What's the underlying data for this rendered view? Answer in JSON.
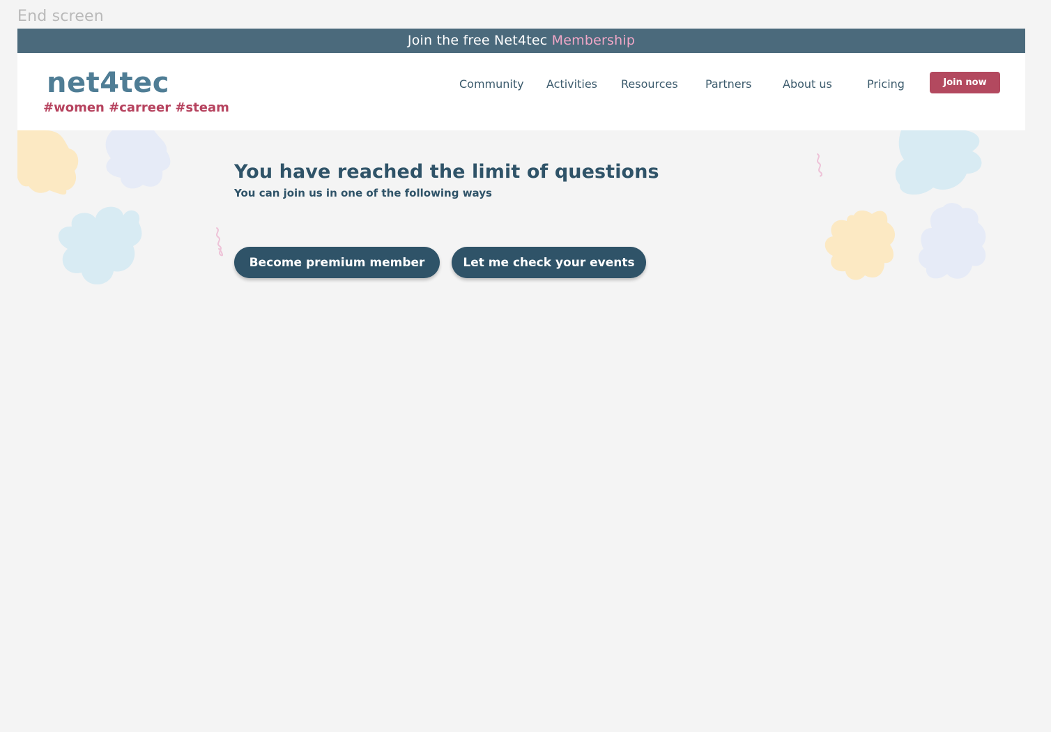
{
  "frame_label": "End screen",
  "promo": {
    "text": "Join the free Net4tec ",
    "highlight": "Membership"
  },
  "brand": {
    "logo": "net4tec",
    "tagline": "#women #carreer #steam"
  },
  "nav": {
    "items": [
      {
        "label": "Community"
      },
      {
        "label": "Activities"
      },
      {
        "label": "Resources"
      },
      {
        "label": "Partners"
      },
      {
        "label": "About us"
      },
      {
        "label": "Pricing"
      }
    ],
    "cta_label": "Join now"
  },
  "main": {
    "headline": "You have reached the limit of questions",
    "subline": "You can join us in one of the following ways",
    "buttons": [
      {
        "label": "Become premium member"
      },
      {
        "label": "Let me check your events"
      }
    ]
  },
  "colors": {
    "promo_bar": "#4b6a7c",
    "membership_highlight": "#f0a7c7",
    "logo": "#4f7d95",
    "tagline": "#b6425e",
    "nav_text": "#3b5a6c",
    "join_button": "#b3495f",
    "primary_button": "#2f5368",
    "page_background": "#f4f4f4"
  }
}
